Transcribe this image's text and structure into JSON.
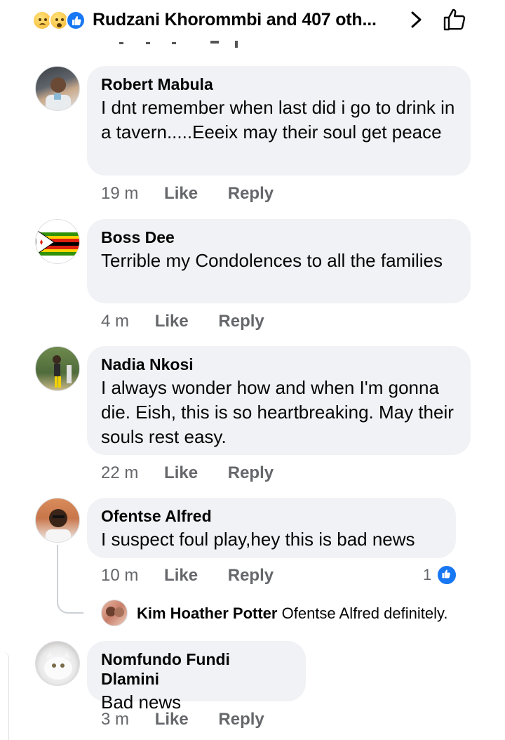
{
  "header": {
    "title": "Rudzani Khorommbi and 407 oth...",
    "reactions": [
      "sad-icon",
      "wow-icon",
      "like-icon"
    ],
    "chevron_icon": "chevron-right-icon",
    "like_icon": "thumbs-up-outline-icon"
  },
  "comments": [
    {
      "author": "Robert Mabula",
      "text": "I dnt remember when last did i go to drink in a tavern.....Eeeix may their soul get peace",
      "time": "19 m",
      "like": "Like",
      "reply": "Reply"
    },
    {
      "author": "Boss Dee",
      "text": "Terrible my Condolences to all the families",
      "time": "4 m",
      "like": "Like",
      "reply": "Reply"
    },
    {
      "author": "Nadia Nkosi",
      "text": "I always wonder how and when I'm gonna die. Eish, this is so heartbreaking. May their souls rest easy.",
      "time": "22 m",
      "like": "Like",
      "reply": "Reply"
    },
    {
      "author": "Ofentse Alfred",
      "text": "I suspect foul play,hey this is bad news",
      "time": "10 m",
      "like": "Like",
      "reply": "Reply",
      "reaction_count": "1",
      "reply_preview": {
        "author": "Kim Hoather Potter",
        "text": "Ofentse Alfred definitely."
      }
    },
    {
      "author": "Nomfundo Fundi Dlamini",
      "text": "Bad news",
      "time": "3 m",
      "like": "Like",
      "reply": "Reply"
    }
  ],
  "colors": {
    "bubble": "#f0f2f5",
    "meta": "#65676b",
    "like_blue": "#1877f2"
  }
}
